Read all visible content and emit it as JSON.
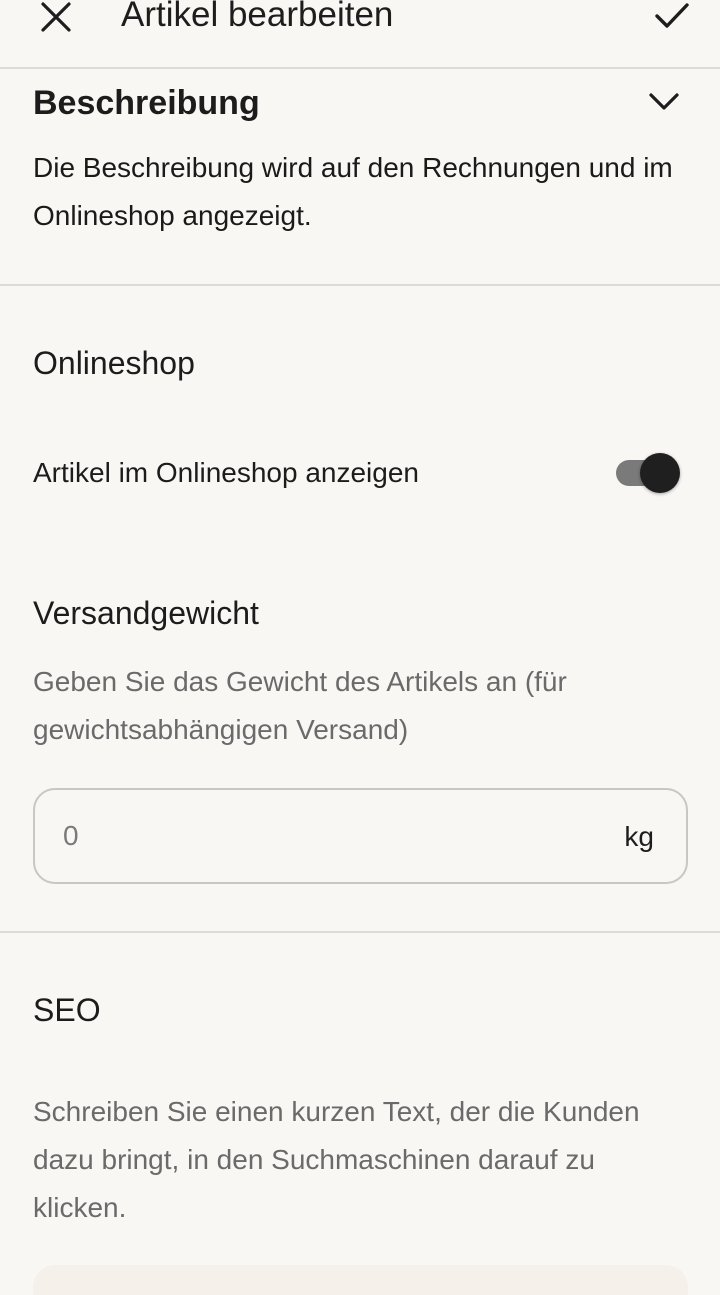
{
  "header": {
    "title": "Artikel bearbeiten",
    "close_icon": "close-icon",
    "confirm_icon": "checkmark-icon"
  },
  "beschreibung": {
    "title": "Beschreibung",
    "chevron_icon": "chevron-down-icon",
    "text": "Die Beschreibung wird auf den Rechnungen und im Onlineshop angezeigt."
  },
  "onlineshop": {
    "title": "Onlineshop",
    "toggle_label": "Artikel im Onlineshop anzeigen",
    "toggle_on": true
  },
  "versandgewicht": {
    "title": "Versandgewicht",
    "help": "Geben Sie das Gewicht des Artikels an (für gewichtsabhängigen Versand)",
    "placeholder": "0",
    "unit": "kg"
  },
  "seo": {
    "title": "SEO",
    "help": "Schreiben Sie einen kurzen Text, der die Kunden dazu bringt, in den Suchmaschinen darauf zu klicken."
  },
  "colors": {
    "background": "#f8f7f4",
    "divider": "#dcdbd8",
    "text_primary": "#1c1c1c",
    "text_secondary": "#6a6a6a",
    "toggle_knob": "#1f1f1f",
    "toggle_track": "#7a7a7a"
  }
}
